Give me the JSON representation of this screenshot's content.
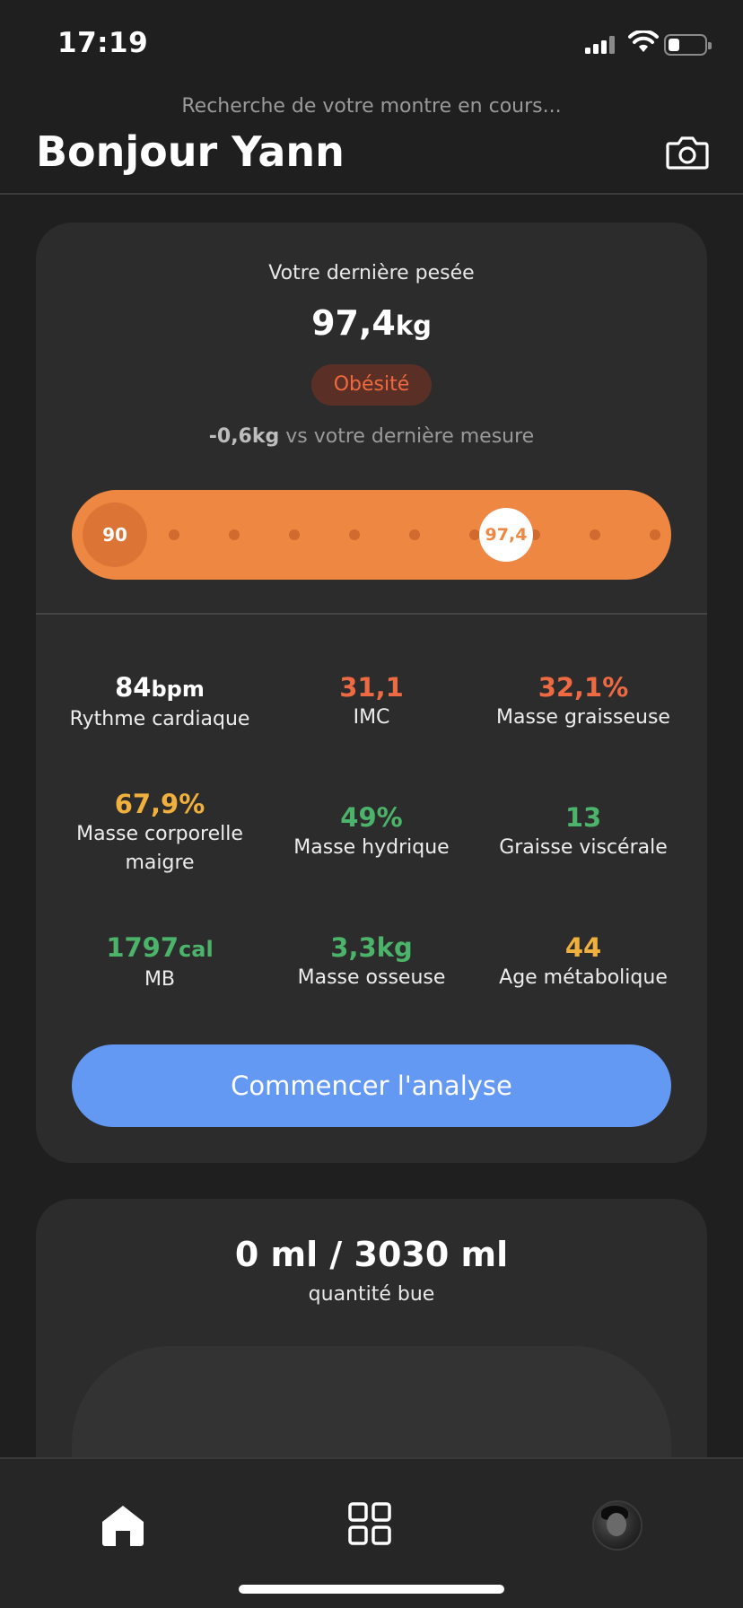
{
  "status_bar": {
    "time": "17:19"
  },
  "header": {
    "searching_text": "Recherche de votre montre en cours...",
    "greeting": "Bonjour Yann"
  },
  "weight_card": {
    "label": "Votre dernière pesée",
    "value": "97,4",
    "unit": "kg",
    "category": "Obésité",
    "delta_value": "-0,6kg",
    "delta_text": " vs votre dernière mesure",
    "scale_start": "90",
    "scale_current": "97,4",
    "cta_label": "Commencer l'analyse"
  },
  "metrics": [
    {
      "value": "84",
      "unit": "bpm",
      "label": "Rythme cardiaque",
      "color": "#ffffff"
    },
    {
      "value": "31,1",
      "unit": "",
      "label": "IMC",
      "color": "#ee6a43"
    },
    {
      "value": "32,1%",
      "unit": "",
      "label": "Masse graisseuse",
      "color": "#ee6a43"
    },
    {
      "value": "67,9%",
      "unit": "",
      "label": "Masse corporelle maigre",
      "color": "#f0b03e"
    },
    {
      "value": "49%",
      "unit": "",
      "label": "Masse hydrique",
      "color": "#4cb46a"
    },
    {
      "value": "13",
      "unit": "",
      "label": "Graisse viscérale",
      "color": "#4cb46a"
    },
    {
      "value": "1797",
      "unit": "cal",
      "label": "MB",
      "color": "#4cb46a"
    },
    {
      "value": "3,3kg",
      "unit": "",
      "label": "Masse osseuse",
      "color": "#4cb46a"
    },
    {
      "value": "44",
      "unit": "",
      "label": "Age métabolique",
      "color": "#f0b03e"
    }
  ],
  "water_card": {
    "value": "0 ml / 3030 ml",
    "label": "quantité bue"
  },
  "tab_bar": {
    "tabs": [
      {
        "icon": "home-icon",
        "active": true
      },
      {
        "icon": "grid-icon",
        "active": false
      },
      {
        "icon": "avatar",
        "active": false
      }
    ]
  }
}
